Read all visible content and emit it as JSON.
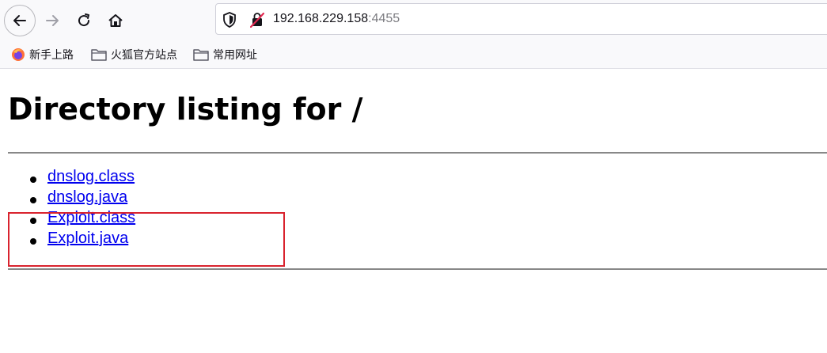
{
  "browser": {
    "url_host": "192.168.229.158",
    "url_port": ":4455"
  },
  "bookmarks": [
    {
      "label": "新手上路",
      "icon": "firefox-icon"
    },
    {
      "label": "火狐官方站点",
      "icon": "folder-icon"
    },
    {
      "label": "常用网址",
      "icon": "folder-icon"
    }
  ],
  "page": {
    "title": "Directory listing for /",
    "files": [
      {
        "name": "dnslog.class"
      },
      {
        "name": "dnslog.java"
      },
      {
        "name": "Exploit.class"
      },
      {
        "name": "Exploit.java"
      }
    ]
  },
  "colors": {
    "link": "#0000ee",
    "annotation": "#d9232e"
  }
}
